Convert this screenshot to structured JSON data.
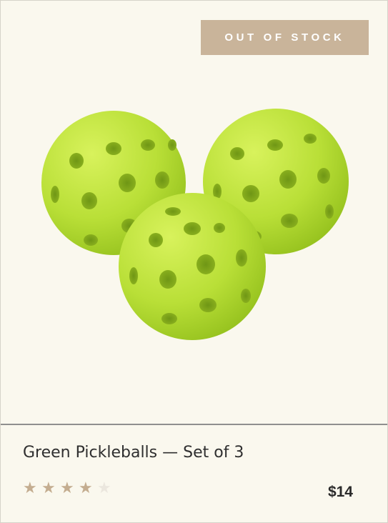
{
  "badge": {
    "text": "OUT OF STOCK"
  },
  "product": {
    "title": "Green Pickleballs — Set of 3",
    "price": "$14",
    "rating": {
      "filled": 4,
      "total": 5
    },
    "image_alt": "three green pickleballs"
  },
  "colors": {
    "background": "#faf8ee",
    "badge_bg": "#c9b49a",
    "star_filled": "#c4ad90",
    "star_empty": "#ebe7de",
    "ball": "#b7df39"
  },
  "icons": [
    "star-icon"
  ]
}
